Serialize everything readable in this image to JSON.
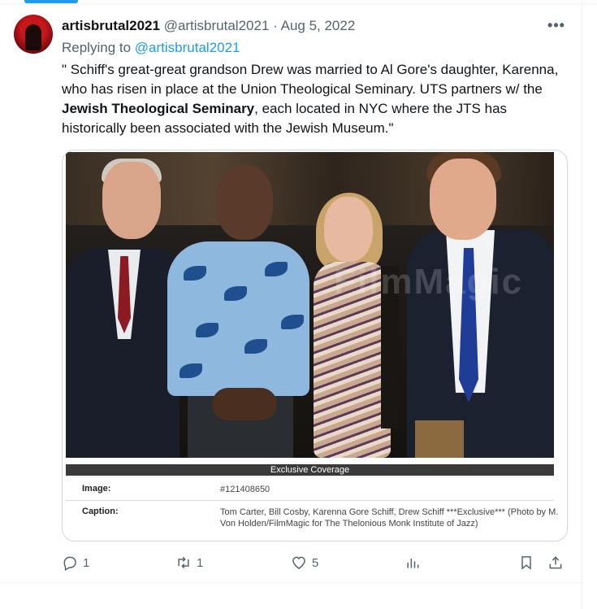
{
  "tweet": {
    "display_name": "artisbrutal2021",
    "handle": "@artisbrutal2021",
    "separator": "·",
    "date": "Aug 5, 2022",
    "more_label": "•••",
    "reply_prefix": "Replying to",
    "reply_to": "@artisbrutal2021",
    "text_part1": "\" Schiff's great-great grandson Drew was married to Al Gore's daughter, Karenna, who has risen in place at the Union Theological Seminary. UTS partners w/ the ",
    "text_bold": "Jewish Theological Seminary",
    "text_part2": ", each located in NYC where the JTS has historically been associated with the Jewish Museum.\""
  },
  "media": {
    "watermark": "FilmMagic",
    "banner": "Exclusive Coverage",
    "image_label": "Image:",
    "image_value": "#121408650",
    "caption_label": "Caption:",
    "caption_value": "Tom Carter, Bill Cosby, Karenna Gore Schiff, Drew Schiff ***Exclusive*** (Photo by M. Von Holden/FilmMagic for The Thelonious Monk Institute of Jazz)"
  },
  "actions": {
    "reply_count": "1",
    "retweet_count": "1",
    "like_count": "5",
    "views_count": "",
    "icons": [
      "reply-icon",
      "retweet-icon",
      "like-icon",
      "views-icon",
      "bookmark-icon",
      "share-icon"
    ]
  },
  "colors": {
    "accent": "#1d9bf0",
    "secondary_text": "#536471",
    "primary_text": "#0f1419"
  }
}
